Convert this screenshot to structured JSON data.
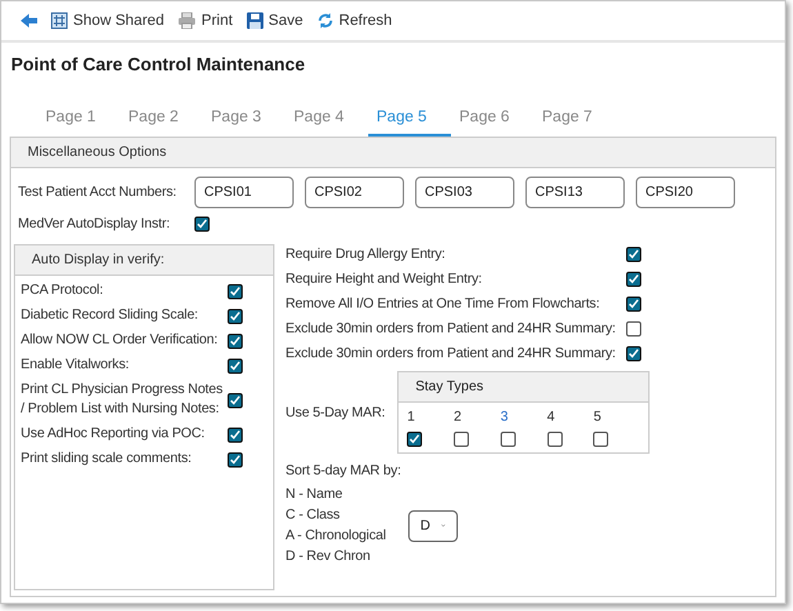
{
  "toolbar": [
    {
      "kind": "back"
    },
    {
      "kind": "shared",
      "label": "Show Shared"
    },
    {
      "kind": "print",
      "label": "Print"
    },
    {
      "kind": "save",
      "label": "Save"
    },
    {
      "kind": "refresh",
      "label": "Refresh"
    }
  ],
  "title": "Point of Care Control Maintenance",
  "tabs": [
    {
      "label": "Page 1",
      "selected": false
    },
    {
      "label": "Page 2",
      "selected": false
    },
    {
      "label": "Page 3",
      "selected": false
    },
    {
      "label": "Page 4",
      "selected": false
    },
    {
      "label": "Page 5",
      "selected": true
    },
    {
      "label": "Page 6",
      "selected": false
    },
    {
      "label": "Page 7",
      "selected": false
    }
  ],
  "misc": {
    "header": "Miscellaneous Options",
    "acct_label": "Test Patient Acct Numbers:",
    "acct_numbers": [
      "CPSI01",
      "CPSI02",
      "CPSI03",
      "CPSI13",
      "CPSI20"
    ],
    "medver_label": "MedVer AutoDisplay Instr:",
    "medver_checked": true
  },
  "auto_display": {
    "header": "Auto Display in verify:",
    "items": [
      {
        "label": "PCA Protocol:",
        "checked": true
      },
      {
        "label": "Diabetic Record Sliding Scale:",
        "checked": true
      },
      {
        "label": "Allow NOW CL Order Verification:",
        "checked": true
      },
      {
        "label": "Enable Vitalworks:",
        "checked": true
      },
      {
        "label": "Print CL Physician Progress Notes / Problem List with Nursing Notes:",
        "checked": true
      },
      {
        "label": "Use AdHoc Reporting via POC:",
        "checked": true
      },
      {
        "label": "Print sliding scale comments:",
        "checked": true
      }
    ]
  },
  "options": [
    {
      "label": "Require Drug Allergy Entry:",
      "checked": true
    },
    {
      "label": "Require Height and Weight Entry:",
      "checked": true
    },
    {
      "label": "Remove All I/O Entries at One Time From Flowcharts:",
      "checked": true
    },
    {
      "label": "Exclude 30min orders from Patient and 24HR Summary:",
      "checked": false
    },
    {
      "label": "Exclude 30min orders from Patient and 24HR Summary:",
      "checked": true
    }
  ],
  "mar": {
    "label": "Use 5-Day MAR:",
    "header": "Stay Types",
    "stay_types": [
      {
        "label": "1",
        "checked": true,
        "highlighted": false
      },
      {
        "label": "2",
        "checked": false,
        "highlighted": false
      },
      {
        "label": "3",
        "checked": false,
        "highlighted": true
      },
      {
        "label": "4",
        "checked": false,
        "highlighted": false
      },
      {
        "label": "5",
        "checked": false,
        "highlighted": false
      }
    ]
  },
  "sort": {
    "label": "Sort 5-day MAR by:",
    "options": [
      "N - Name",
      "C - Class",
      "A - Chronological",
      "D - Rev Chron"
    ],
    "value": "D"
  }
}
